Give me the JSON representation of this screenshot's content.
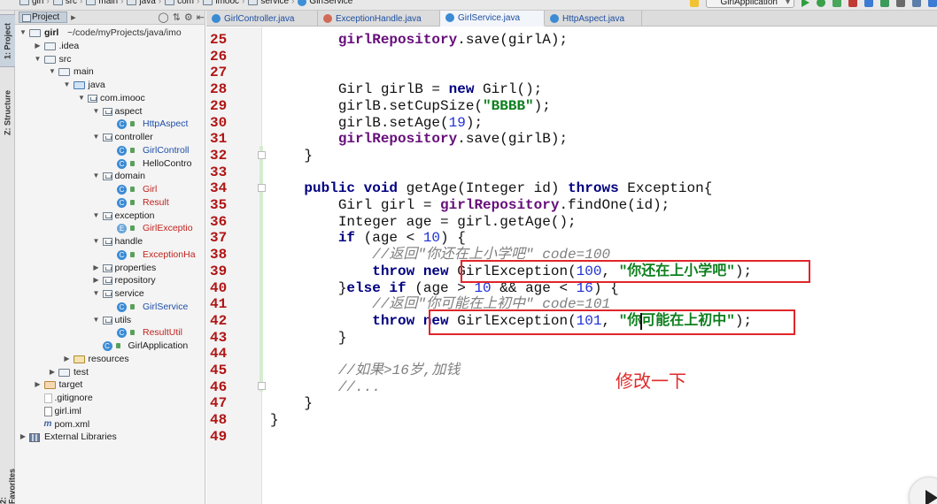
{
  "breadcrumb": [
    "girl",
    "src",
    "main",
    "java",
    "com",
    "imooc",
    "service",
    "GirlService"
  ],
  "run_config": "GirlApplication",
  "tool_windows": {
    "project_tab": "1: Project",
    "structure_tab": "Z: Structure",
    "favorites_tab": "2: Favorites"
  },
  "project_panel": {
    "view_selector": "Project",
    "tree": [
      {
        "label": "girl",
        "suffix": "~/code/myProjects/java/imo",
        "depth": 0,
        "arrow": "open",
        "icon": "folder",
        "color": "default"
      },
      {
        "label": ".idea",
        "depth": 1,
        "arrow": "closed",
        "icon": "folder",
        "color": "default"
      },
      {
        "label": "src",
        "depth": 1,
        "arrow": "open",
        "icon": "folder",
        "color": "default"
      },
      {
        "label": "main",
        "depth": 2,
        "arrow": "open",
        "icon": "folder",
        "color": "default"
      },
      {
        "label": "java",
        "depth": 3,
        "arrow": "open",
        "icon": "folder-src",
        "color": "default"
      },
      {
        "label": "com.imooc",
        "depth": 4,
        "arrow": "open",
        "icon": "package",
        "color": "default"
      },
      {
        "label": "aspect",
        "depth": 5,
        "arrow": "open",
        "icon": "package",
        "color": "default"
      },
      {
        "label": "HttpAspect",
        "depth": 6,
        "arrow": "none",
        "icon": "class",
        "color": "blue"
      },
      {
        "label": "controller",
        "depth": 5,
        "arrow": "open",
        "icon": "package",
        "color": "default"
      },
      {
        "label": "GirlControll",
        "depth": 6,
        "arrow": "none",
        "icon": "class",
        "color": "blue"
      },
      {
        "label": "HelloContro",
        "depth": 6,
        "arrow": "none",
        "icon": "class",
        "color": "default"
      },
      {
        "label": "domain",
        "depth": 5,
        "arrow": "open",
        "icon": "package",
        "color": "default"
      },
      {
        "label": "Girl",
        "depth": 6,
        "arrow": "none",
        "icon": "class",
        "color": "red"
      },
      {
        "label": "Result",
        "depth": 6,
        "arrow": "none",
        "icon": "class",
        "color": "red"
      },
      {
        "label": "exception",
        "depth": 5,
        "arrow": "open",
        "icon": "package",
        "color": "default"
      },
      {
        "label": "GirlExceptio",
        "depth": 6,
        "arrow": "none",
        "icon": "class-exc",
        "color": "red"
      },
      {
        "label": "handle",
        "depth": 5,
        "arrow": "open",
        "icon": "package",
        "color": "default"
      },
      {
        "label": "ExceptionHa",
        "depth": 6,
        "arrow": "none",
        "icon": "class",
        "color": "red"
      },
      {
        "label": "properties",
        "depth": 5,
        "arrow": "closed",
        "icon": "package",
        "color": "default"
      },
      {
        "label": "repository",
        "depth": 5,
        "arrow": "closed",
        "icon": "package",
        "color": "default"
      },
      {
        "label": "service",
        "depth": 5,
        "arrow": "open",
        "icon": "package",
        "color": "default"
      },
      {
        "label": "GirlService",
        "depth": 6,
        "arrow": "none",
        "icon": "class",
        "color": "blue"
      },
      {
        "label": "utils",
        "depth": 5,
        "arrow": "open",
        "icon": "package",
        "color": "default"
      },
      {
        "label": "ResultUtil",
        "depth": 6,
        "arrow": "none",
        "icon": "class",
        "color": "red"
      },
      {
        "label": "GirlApplication",
        "depth": 5,
        "arrow": "none",
        "icon": "class-app",
        "color": "default"
      },
      {
        "label": "resources",
        "depth": 3,
        "arrow": "closed",
        "icon": "folder-res",
        "color": "default"
      },
      {
        "label": "test",
        "depth": 2,
        "arrow": "closed",
        "icon": "folder",
        "color": "default"
      },
      {
        "label": "target",
        "depth": 1,
        "arrow": "closed",
        "icon": "folder-orange",
        "color": "default"
      },
      {
        "label": ".gitignore",
        "depth": 1,
        "arrow": "none",
        "icon": "file",
        "color": "default"
      },
      {
        "label": "girl.iml",
        "depth": 1,
        "arrow": "none",
        "icon": "file-iml",
        "color": "default"
      },
      {
        "label": "pom.xml",
        "depth": 1,
        "arrow": "none",
        "icon": "xml",
        "color": "default"
      },
      {
        "label": "External Libraries",
        "depth": 0,
        "arrow": "closed",
        "icon": "library",
        "color": "default"
      }
    ]
  },
  "tabs": [
    {
      "label": "GirlController.java",
      "icon": "class",
      "active": false
    },
    {
      "label": "ExceptionHandle.java",
      "icon": "class-exc",
      "active": false
    },
    {
      "label": "GirlService.java",
      "icon": "class",
      "active": true
    },
    {
      "label": "HttpAspect.java",
      "icon": "class",
      "active": false
    }
  ],
  "editor": {
    "lines": [
      {
        "n": "25",
        "code": [
          [
            "",
            "        "
          ],
          [
            "fld",
            "girlRepository"
          ],
          [
            "",
            ".save(girlA);"
          ]
        ]
      },
      {
        "n": "26",
        "code": []
      },
      {
        "n": "27",
        "code": []
      },
      {
        "n": "28",
        "code": [
          [
            "",
            "        Girl girlB = "
          ],
          [
            "kw",
            "new"
          ],
          [
            "",
            " Girl();"
          ]
        ]
      },
      {
        "n": "29",
        "code": [
          [
            "",
            "        girlB.setCupSize("
          ],
          [
            "str",
            "\"BBBB\""
          ],
          [
            "",
            ");"
          ]
        ]
      },
      {
        "n": "30",
        "code": [
          [
            "",
            "        girlB.setAge("
          ],
          [
            "num",
            "19"
          ],
          [
            "",
            ");"
          ]
        ]
      },
      {
        "n": "31",
        "code": [
          [
            "",
            "        "
          ],
          [
            "fld",
            "girlRepository"
          ],
          [
            "",
            ".save(girlB);"
          ]
        ]
      },
      {
        "n": "32",
        "code": [
          [
            "",
            "    }"
          ]
        ]
      },
      {
        "n": "33",
        "code": []
      },
      {
        "n": "34",
        "code": [
          [
            "",
            "    "
          ],
          [
            "kw",
            "public void"
          ],
          [
            "",
            " getAge(Integer id) "
          ],
          [
            "kw",
            "throws"
          ],
          [
            "",
            " Exception{"
          ]
        ]
      },
      {
        "n": "35",
        "code": [
          [
            "",
            "        Girl girl = "
          ],
          [
            "fld",
            "girlRepository"
          ],
          [
            "",
            ".findOne(id);"
          ]
        ]
      },
      {
        "n": "36",
        "code": [
          [
            "",
            "        Integer age = girl.getAge();"
          ]
        ]
      },
      {
        "n": "37",
        "code": [
          [
            "",
            "        "
          ],
          [
            "kw",
            "if"
          ],
          [
            "",
            " (age < "
          ],
          [
            "num",
            "10"
          ],
          [
            "",
            ") {"
          ]
        ]
      },
      {
        "n": "38",
        "code": [
          [
            "",
            "            "
          ],
          [
            "cmt",
            "//返回\"你还在上小学吧\" code=100"
          ]
        ]
      },
      {
        "n": "39",
        "code": [
          [
            "",
            "            "
          ],
          [
            "kw",
            "throw new"
          ],
          [
            "",
            " GirlException("
          ],
          [
            "num",
            "100"
          ],
          [
            "",
            ", "
          ],
          [
            "str",
            "\"你还在上小学吧\""
          ],
          [
            "",
            ");"
          ]
        ]
      },
      {
        "n": "40",
        "code": [
          [
            "",
            "        }"
          ],
          [
            "kw",
            "else if"
          ],
          [
            "",
            " (age > "
          ],
          [
            "num",
            "10"
          ],
          [
            "",
            " && age < "
          ],
          [
            "num",
            "16"
          ],
          [
            "",
            ") {"
          ]
        ]
      },
      {
        "n": "41",
        "code": [
          [
            "",
            "            "
          ],
          [
            "cmt",
            "//返回\"你可能在上初中\" code=101"
          ]
        ]
      },
      {
        "n": "42",
        "code": [
          [
            "",
            "            "
          ],
          [
            "kw",
            "throw new"
          ],
          [
            "",
            " GirlException("
          ],
          [
            "num",
            "101"
          ],
          [
            "",
            ", "
          ],
          [
            "str",
            "\"你可能在上初中\""
          ],
          [
            "",
            ");"
          ]
        ]
      },
      {
        "n": "43",
        "code": [
          [
            "",
            "        }"
          ]
        ]
      },
      {
        "n": "44",
        "code": []
      },
      {
        "n": "45",
        "code": [
          [
            "",
            "        "
          ],
          [
            "cmt",
            "//如果>16岁,加钱"
          ]
        ]
      },
      {
        "n": "46",
        "code": [
          [
            "",
            "        "
          ],
          [
            "cmt",
            "//..."
          ]
        ]
      },
      {
        "n": "47",
        "code": [
          [
            "",
            "    }"
          ]
        ]
      },
      {
        "n": "48",
        "code": [
          [
            "",
            "}"
          ]
        ]
      },
      {
        "n": "49",
        "code": []
      }
    ],
    "annotation": "修改一下",
    "colors": {
      "keyword": "#000080",
      "field": "#660e7a",
      "string": "#0d7f1d",
      "number": "#1d2fd6",
      "comment": "#808080",
      "line_number": "#b01515",
      "highlight_box": "#e0262a"
    }
  }
}
